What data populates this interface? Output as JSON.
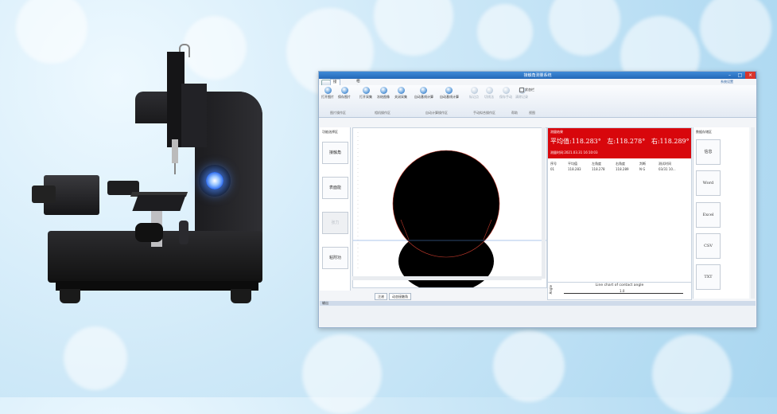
{
  "window": {
    "title": "接触角测量系统",
    "tabs": [
      "接触角",
      "相机设置"
    ],
    "right_links": "系统设置"
  },
  "ribbon": {
    "buttons": [
      "打开图片",
      "保存图片",
      "打开采集",
      "冻结图像",
      "关闭采集",
      "自动基线计算",
      "自动基线计算",
      "标记点",
      "切线法",
      "保存手动",
      "清除记录"
    ],
    "groups": [
      "图片操作区",
      "相机操作区",
      "自动计算操作区",
      "手动拟合操作区",
      "帮助",
      "视图"
    ],
    "checkbox": "状态栏"
  },
  "left_pane": {
    "title": "功能选择区",
    "buttons": [
      "接触角",
      "表面能",
      "张力",
      "粘附功"
    ]
  },
  "image_tabs": [
    "注液",
    "动态接触角"
  ],
  "results": {
    "header": "测量结果",
    "average": "平均值:118.283°",
    "left": "左:118.278°",
    "right": "右:118.289°",
    "measure_time": "测量时间:2021.03.31 16:10:03",
    "columns": [
      "序号",
      "平均值",
      "左角度",
      "右角度",
      "判断",
      "测试时间"
    ],
    "rows": [
      [
        "01",
        "118.283",
        "118.278",
        "118.289",
        "N G",
        "03/31 10..."
      ]
    ]
  },
  "chart_data": {
    "type": "line",
    "title": "Line chart of contact angle",
    "ylabel": "Angle",
    "y_ticks": [
      "1.0"
    ],
    "series": []
  },
  "right_pane": {
    "title": "数据存储区",
    "buttons": [
      "信息",
      "Word",
      "Excel",
      "CSV",
      "TXT"
    ]
  },
  "output_bar": {
    "label": "输出"
  },
  "colors": {
    "titlebar": "#2468b7",
    "result_red": "#d8070c",
    "drop_black": "#000000",
    "baseline_blue": "#5b8fd8"
  }
}
